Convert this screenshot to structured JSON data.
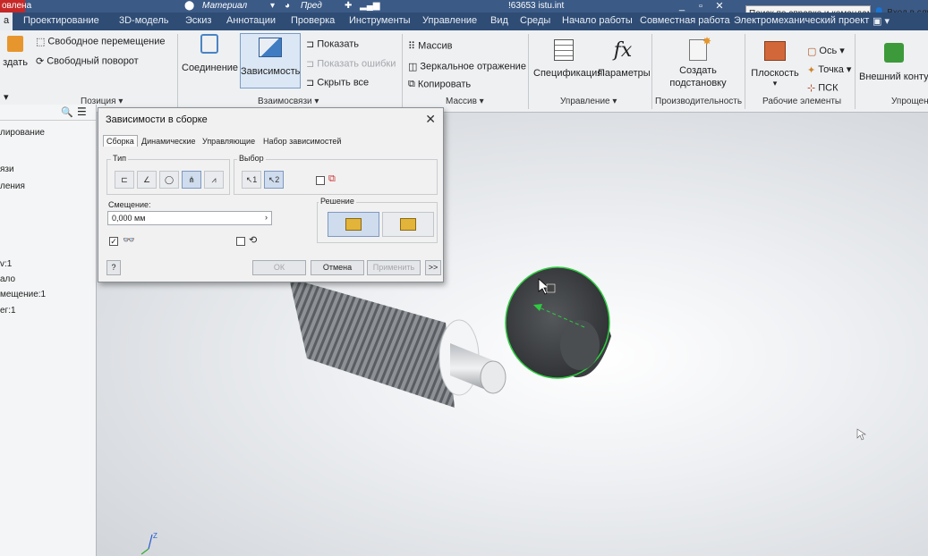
{
  "titlebar": {
    "left_fragment": "овлена",
    "material_label": "Материал",
    "appearance_label": "Пред",
    "file_name": "!63653 istu.int",
    "search_text": "Поиск по справке и командам",
    "signin_text": "Вход в слу"
  },
  "tabs": [
    "а",
    "Проектирование",
    "3D-модель",
    "Эскиз",
    "Аннотации",
    "Проверка",
    "Инструменты",
    "Управление",
    "Вид",
    "Среды",
    "Начало работы",
    "Совместная работа",
    "Электромеханический проект"
  ],
  "ribbon": {
    "create_label": "здать",
    "free_move": "Свободное перемещение",
    "free_rotate": "Свободный поворот",
    "position_panel": "Позиция ▾",
    "join": "Соединение",
    "constraint": "Зависимость",
    "show": "Показать",
    "show_errors": "Показать ошибки",
    "hide_all": "Скрыть все",
    "relationships_panel": "Взаимосвязи ▾",
    "pattern": "Массив",
    "mirror": "Зеркальное отражение",
    "copy": "Копировать",
    "pattern_panel": "Массив ▾",
    "specification": "Спецификация",
    "parameters": "Параметры",
    "manage_panel": "Управление ▾",
    "create_substitute": "Создать подстановку",
    "productivity_panel": "Производительность",
    "plane": "Плоскость",
    "axis": "Ось ▾",
    "point": "Точка ▾",
    "ucs": "ПСК",
    "work_features_panel": "Рабочие элементы",
    "shrinkwrap": "Внешний контур",
    "simplification_panel": "Упрощен"
  },
  "browser": {
    "items": [
      "лирование",
      "язи",
      "ления",
      "v:1",
      "ало",
      "мещение:1",
      "ег:1"
    ]
  },
  "dialog": {
    "title": "Зависимости в сборке",
    "tabs": [
      "Сборка",
      "Динамические",
      "Управляющие",
      "Набор зависимостей"
    ],
    "type_label": "Тип",
    "selection_label": "Выбор",
    "offset_label": "Смещение:",
    "offset_value": "0,000 мм",
    "solution_label": "Решение",
    "select1": "1",
    "select2": "2",
    "ok": "ОК",
    "cancel": "Отмена",
    "apply": "Применить",
    "more": ">>",
    "preview_checked": "✓"
  },
  "colors": {
    "tab_bar": "#2f4c74",
    "title_bar": "#3b5a86",
    "selection_green": "#2ecc40",
    "dark_part": "#3f4245"
  }
}
